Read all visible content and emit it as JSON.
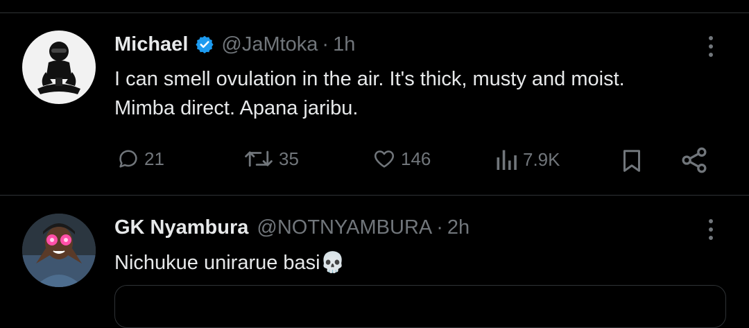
{
  "tweet1": {
    "display_name": "Michael",
    "handle": "@JaMtoka",
    "time": "1h",
    "text_line1": "I can smell ovulation in the air. It's thick, musty and moist.",
    "text_line2": "Mimba direct. Apana jaribu.",
    "replies": "21",
    "retweets": "35",
    "likes": "146",
    "views": "7.9K"
  },
  "tweet2": {
    "display_name": "GK Nyambura",
    "handle": "@NOTNYAMBURA",
    "time": "2h",
    "text": "Nichukue unirarue basi💀"
  },
  "separator": "·",
  "colors": {
    "background": "#000000",
    "text": "#e7e9ea",
    "muted": "#71767b",
    "verified": "#1d9bf0",
    "divider": "#2f3336"
  }
}
